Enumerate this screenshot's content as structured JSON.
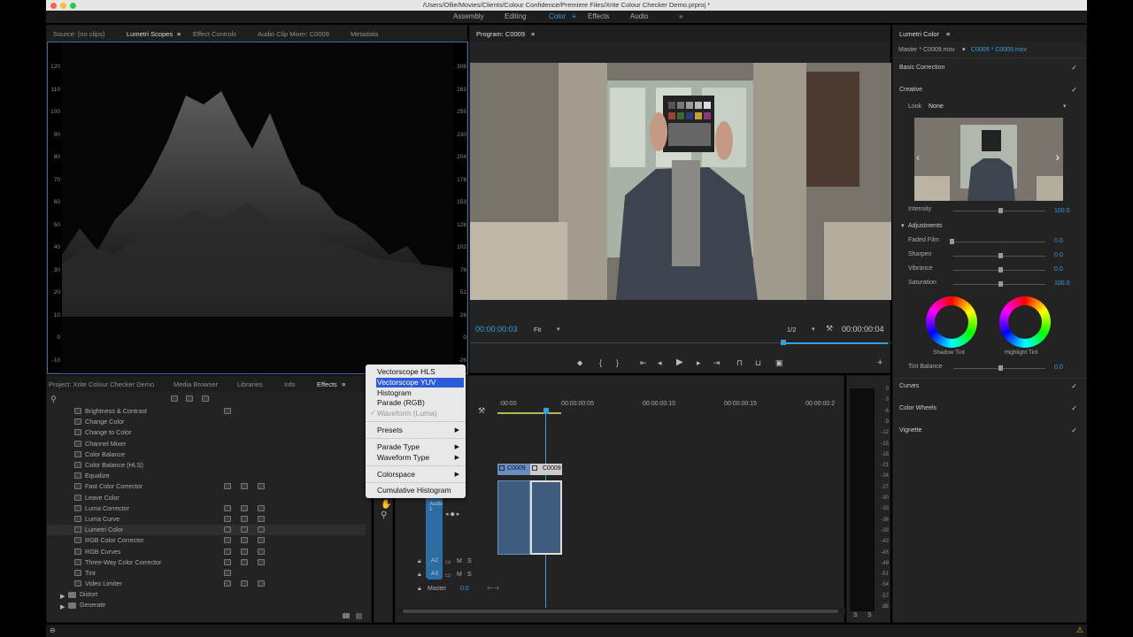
{
  "window": {
    "title": "/Users/Ollie/Movies/Clients/Colour Confidence/Premiere Files/Xrite Colour Checker Demo.prproj *"
  },
  "workspaces": [
    "Assembly",
    "Editing",
    "Color",
    "Effects",
    "Audio"
  ],
  "source_panel": {
    "tabs": [
      "Source: (no clips)",
      "Lumetri Scopes",
      "Effect Controls",
      "Audio Clip Mixer: C0009",
      "Metadata"
    ],
    "left_scale": [
      "120",
      "110",
      "100",
      "90",
      "80",
      "70",
      "60",
      "50",
      "40",
      "30",
      "20",
      "10",
      "0",
      "-10",
      "-20"
    ],
    "right_scale": [
      "306",
      "281",
      "255",
      "230",
      "204",
      "178",
      "153",
      "128",
      "102",
      "76",
      "51",
      "26",
      "0",
      "-26",
      "-51"
    ]
  },
  "scope_menu": {
    "items": [
      "Vectorscope HLS",
      "Vectorscope YUV",
      "Histogram",
      "Parade (RGB)",
      "Waveform (Luma)",
      "Presets",
      "Parade Type",
      "Waveform Type",
      "Colorspace",
      "Cumulative Histogram"
    ],
    "checkmark": "✓"
  },
  "program": {
    "title": "Program: C0009",
    "timecode": "00:00:00:03",
    "zoom": "Fit",
    "resolution": "1/2",
    "duration": "00:00:00:04"
  },
  "project_panel": {
    "tabs": [
      "Project: Xrite Colour Checker Demo",
      "Media Browser",
      "Libraries",
      "Info",
      "Effects"
    ],
    "effects": [
      "Brightness & Contrast",
      "Change Color",
      "Change to Color",
      "Channel Mixer",
      "Color Balance",
      "Color Balance (HLS)",
      "Equalize",
      "Fast Color Corrector",
      "Leave Color",
      "Luma Corrector",
      "Luma Curve",
      "Lumetri Color",
      "RGB Color Corrector",
      "RGB Curves",
      "Three-Way Color Corrector",
      "Tint",
      "Video Limiter"
    ],
    "folders": [
      "Distort",
      "Generate"
    ]
  },
  "timeline": {
    "ruler": [
      ":00:00",
      "00:00:00:05",
      "00:00:00:10",
      "00:00:00:15",
      "00:00:00:2"
    ],
    "clip_label": "C0009",
    "clip_label2": "C0009",
    "tracks": [
      "A2",
      "A3"
    ],
    "track_audio1": "Audio 1",
    "master_label": "Master",
    "master_value": "0.0",
    "m": "M",
    "s": "S"
  },
  "meter": {
    "scale": [
      "0",
      "-3",
      "-6",
      "-9",
      "-12",
      "-15",
      "-18",
      "-21",
      "-24",
      "-27",
      "-30",
      "-33",
      "-36",
      "-39",
      "-42",
      "-45",
      "-48",
      "-51",
      "-54",
      "-57",
      "dB"
    ],
    "s1": "S",
    "s2": "S"
  },
  "lumetri": {
    "title": "Lumetri Color",
    "master": "Master * C0009.mov",
    "clip": "C0009 * C0009.mov",
    "basic": "Basic Correction",
    "creative": "Creative",
    "look_label": "Look",
    "look_value": "None",
    "intensity_label": "Intensity",
    "intensity_value": "100.0",
    "adjustments": "Adjustments",
    "faded_label": "Faded Film",
    "faded_value": "0.0",
    "sharpen_label": "Sharpen",
    "sharpen_value": "0.0",
    "vibrance_label": "Vibrance",
    "vibrance_value": "0.0",
    "saturation_label": "Saturation",
    "saturation_value": "100.0",
    "shadow_tint": "Shadow Tint",
    "highlight_tint": "Highlight Tint",
    "tint_balance_label": "Tint Balance",
    "tint_balance_value": "0.0",
    "curves": "Curves",
    "color_wheels": "Color Wheels",
    "vignette": "Vignette",
    "check": "✓"
  }
}
